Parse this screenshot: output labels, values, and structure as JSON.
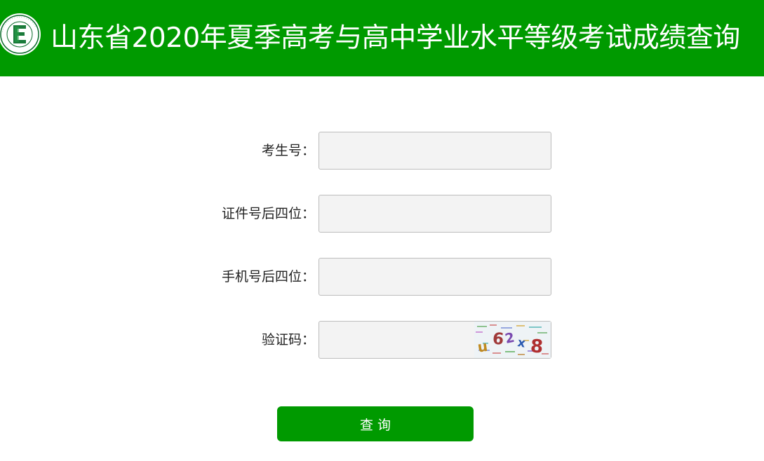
{
  "header": {
    "title": "山东省2020年夏季高考与高中学业水平等级考试成绩查询",
    "logo_icon": "shandong-exam-authority-logo",
    "background_color": "#009a00"
  },
  "form": {
    "fields": [
      {
        "label": "考生号：",
        "value": "",
        "placeholder": ""
      },
      {
        "label": "证件号后四位：",
        "value": "",
        "placeholder": ""
      },
      {
        "label": "手机号后四位：",
        "value": "",
        "placeholder": ""
      },
      {
        "label": "验证码：",
        "value": "",
        "placeholder": ""
      }
    ],
    "captcha_text": "u62x8"
  },
  "query_button": {
    "label": "查询",
    "color": "#009a00"
  }
}
